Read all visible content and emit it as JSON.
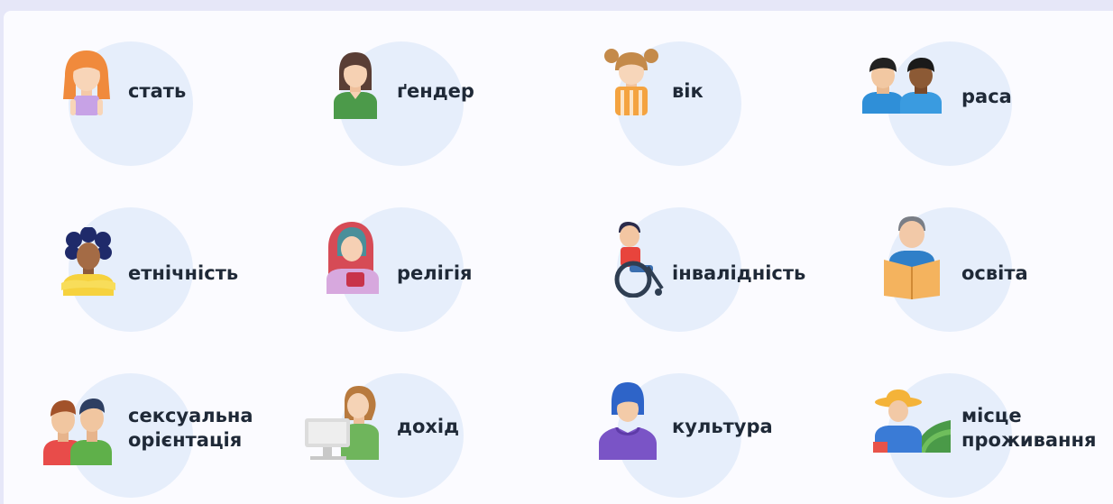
{
  "items": [
    {
      "label": "стать",
      "icon": "girl-icon"
    },
    {
      "label": "ґендер",
      "icon": "person-icon"
    },
    {
      "label": "вік",
      "icon": "child-icon"
    },
    {
      "label": "раса",
      "icon": "two-people-icon"
    },
    {
      "label": "етнічність",
      "icon": "woman-curly-hair-icon"
    },
    {
      "label": "релігія",
      "icon": "woman-headscarf-icon"
    },
    {
      "label": "інвалідність",
      "icon": "wheelchair-user-icon"
    },
    {
      "label": "освіта",
      "icon": "man-reading-book-icon"
    },
    {
      "label": "сексуальна",
      "label2": "орієнтація",
      "icon": "couple-icon"
    },
    {
      "label": "дохід",
      "icon": "woman-at-computer-icon"
    },
    {
      "label": "культура",
      "icon": "person-hoodie-icon"
    },
    {
      "label": "місце",
      "label2": "проживання",
      "icon": "farmer-field-icon"
    }
  ],
  "colors": {
    "background": "#e6e7f8",
    "card": "#fbfbff",
    "circle": "#e6eefb",
    "text": "#1f2937"
  }
}
